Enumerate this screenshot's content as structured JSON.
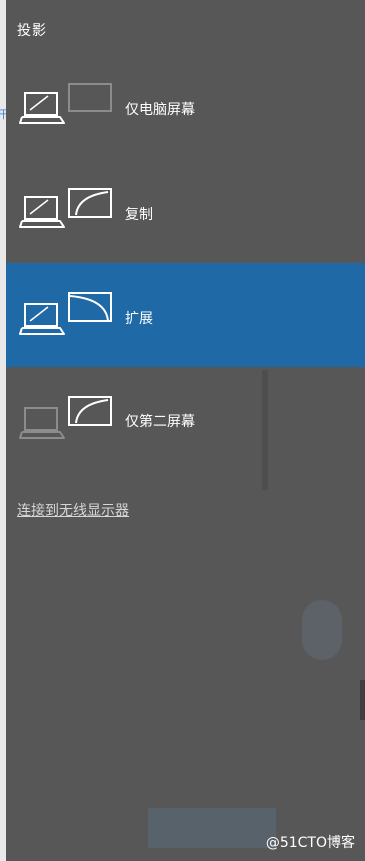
{
  "panel": {
    "title": "投影",
    "options": [
      {
        "label": "仅电脑屏幕",
        "icon": "pc-screen-only-icon",
        "selected": false
      },
      {
        "label": "复制",
        "icon": "duplicate-icon",
        "selected": false
      },
      {
        "label": "扩展",
        "icon": "extend-icon",
        "selected": true
      },
      {
        "label": "仅第二屏幕",
        "icon": "second-screen-only-icon",
        "selected": false
      }
    ],
    "wireless_link": "连接到无线显示器"
  },
  "watermark": "@51CTO博客",
  "colors": {
    "panel_bg": "#575757",
    "selected_bg": "#1f69a6",
    "text": "#ffffff",
    "link": "#d6d6d6"
  }
}
